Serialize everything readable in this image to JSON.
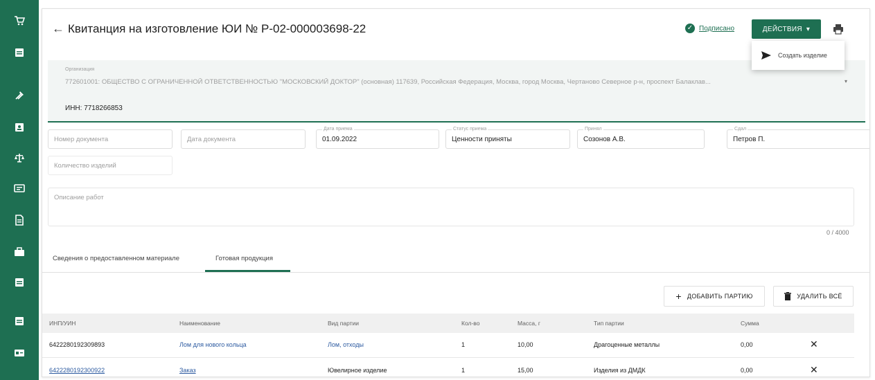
{
  "sidebar": {
    "items": [
      {
        "icon": "shop-cart-icon"
      },
      {
        "icon": "document-icon"
      },
      {
        "icon": "tools-icon"
      },
      {
        "icon": "badge-icon"
      },
      {
        "icon": "scales-icon"
      },
      {
        "icon": "bank-icon"
      },
      {
        "icon": "file-icon"
      },
      {
        "icon": "briefcase-icon"
      },
      {
        "icon": "document-list-icon"
      },
      {
        "icon": "document-list-icon"
      },
      {
        "icon": "card-icon"
      }
    ]
  },
  "header": {
    "title": "Квитанция на изготовление ЮИ № Р-02-000003698-22",
    "signed_label": "Подписано",
    "actions_label": "ДЕЙСТВИЯ",
    "actions_caret": "▾",
    "menu_item_label": "Создать изделие",
    "print_icon": "printer-icon",
    "back_icon": "arrow-left-icon"
  },
  "organization": {
    "caption": "Организация",
    "value": "772601001: ОБЩЕСТВО С ОГРАНИЧЕННОЙ ОТВЕТСТВЕННОСТЬЮ \"МОСКОВСКИЙ ДОКТОР\" (основная) 117639, Российская Федерация, Москва, город Москва, Чертаново Северное р-н, проспект Балаклав...",
    "caret": "▾",
    "inn": "ИНН: 7718266853"
  },
  "form": {
    "doc_number_placeholder": "Номер документа",
    "doc_date_placeholder": "Дата документа",
    "accept_date_caption": "Дата приема",
    "accept_date_value": "01.09.2022",
    "accept_status_caption": "Статус приема",
    "accept_status_value": "Ценности приняты",
    "accepted_by_caption": "Принял",
    "accepted_by_value": "Созонов А.В.",
    "handed_by_caption": "Сдал",
    "handed_by_value": "Петров П.",
    "items_count_placeholder": "Количество изделий",
    "work_description_placeholder": "Описание работ",
    "counter": "0 / 4000"
  },
  "tabs": [
    {
      "label": "Сведения о предоставленном материале"
    },
    {
      "label": "Готовая продукция"
    }
  ],
  "table_actions": {
    "add_label": "ДОБАВИТЬ ПАРТИЮ",
    "add_icon": "plus-icon",
    "delete_label": "УДАЛИТЬ ВСЁ",
    "delete_icon": "trash-icon"
  },
  "table": {
    "headers": [
      "ИНП/УИН",
      "Наименование",
      "Вид партии",
      "Кол-во",
      "Масса, г",
      "Тип партии",
      "Сумма"
    ],
    "rows": [
      {
        "code": "6422280192309893",
        "name": "Лом для нового кольца",
        "kind": "Лом, отходы",
        "qty": "1",
        "mass": "10,00",
        "type": "Драгоценные металлы",
        "sum": "0,00",
        "remove": "✕"
      },
      {
        "code": "6422280192300922",
        "name": "Заказ",
        "kind": "Ювелирное изделие",
        "qty": "1",
        "mass": "15,00",
        "type": "Изделия из ДМДК",
        "sum": "0,00",
        "remove": "✕"
      }
    ]
  },
  "colors": {
    "brand": "#1e6f52",
    "link": "#2c5aa0"
  }
}
